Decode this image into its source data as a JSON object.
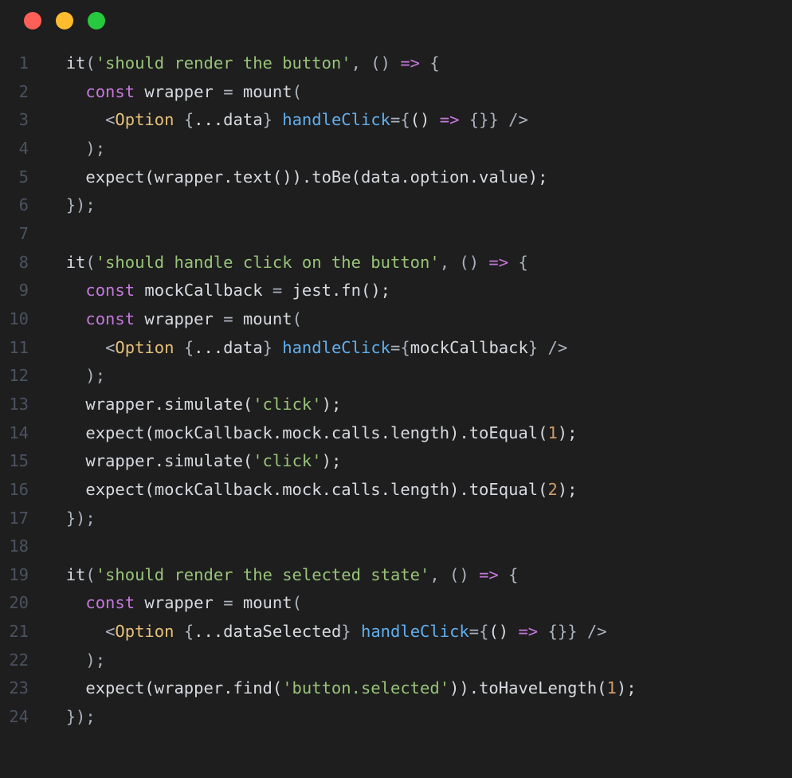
{
  "window": {
    "dots": [
      "red",
      "yellow",
      "green"
    ]
  },
  "colors": {
    "background": "#1e1e1e",
    "gutter": "#4a5260",
    "default": "#d7dae0",
    "keyword": "#c678dd",
    "attribute": "#61afef",
    "component": "#e5c07b",
    "string": "#98c379",
    "number": "#d19a66",
    "arrow": "#c678dd",
    "punct": "#abb2bf"
  },
  "lines": [
    {
      "n": "1",
      "indent": "  ",
      "tokens": [
        {
          "c": "fn",
          "t": "it"
        },
        {
          "c": "punc",
          "t": "("
        },
        {
          "c": "str",
          "t": "'should render the button'"
        },
        {
          "c": "punc",
          "t": ", () "
        },
        {
          "c": "arrow",
          "t": "=>"
        },
        {
          "c": "punc",
          "t": " {"
        }
      ]
    },
    {
      "n": "2",
      "indent": "    ",
      "tokens": [
        {
          "c": "kw",
          "t": "const"
        },
        {
          "c": "fn",
          "t": " wrapper "
        },
        {
          "c": "punc",
          "t": "="
        },
        {
          "c": "fn",
          "t": " mount"
        },
        {
          "c": "punc",
          "t": "("
        }
      ]
    },
    {
      "n": "3",
      "indent": "      ",
      "tokens": [
        {
          "c": "tag",
          "t": "<"
        },
        {
          "c": "comp",
          "t": "Option"
        },
        {
          "c": "fn",
          "t": " "
        },
        {
          "c": "punc",
          "t": "{"
        },
        {
          "c": "fn",
          "t": "...data"
        },
        {
          "c": "punc",
          "t": "} "
        },
        {
          "c": "blue",
          "t": "handleClick"
        },
        {
          "c": "punc",
          "t": "="
        },
        {
          "c": "punc",
          "t": "{"
        },
        {
          "c": "fn",
          "t": "() "
        },
        {
          "c": "arrow",
          "t": "=>"
        },
        {
          "c": "fn",
          "t": " "
        },
        {
          "c": "punc",
          "t": "{}"
        },
        {
          "c": "punc",
          "t": "}"
        },
        {
          "c": "tag",
          "t": " />"
        }
      ]
    },
    {
      "n": "4",
      "indent": "    ",
      "tokens": [
        {
          "c": "punc",
          "t": ");"
        }
      ]
    },
    {
      "n": "5",
      "indent": "    ",
      "tokens": [
        {
          "c": "fn",
          "t": "expect(wrapper.text()).toBe(data.option.value);"
        }
      ]
    },
    {
      "n": "6",
      "indent": "  ",
      "tokens": [
        {
          "c": "punc",
          "t": "});"
        }
      ]
    },
    {
      "n": "7",
      "indent": "",
      "tokens": []
    },
    {
      "n": "8",
      "indent": "  ",
      "tokens": [
        {
          "c": "fn",
          "t": "it"
        },
        {
          "c": "punc",
          "t": "("
        },
        {
          "c": "str",
          "t": "'should handle click on the button'"
        },
        {
          "c": "punc",
          "t": ", () "
        },
        {
          "c": "arrow",
          "t": "=>"
        },
        {
          "c": "punc",
          "t": " {"
        }
      ]
    },
    {
      "n": "9",
      "indent": "    ",
      "tokens": [
        {
          "c": "kw",
          "t": "const"
        },
        {
          "c": "fn",
          "t": " mockCallback "
        },
        {
          "c": "punc",
          "t": "="
        },
        {
          "c": "fn",
          "t": " jest.fn();"
        }
      ]
    },
    {
      "n": "10",
      "indent": "    ",
      "tokens": [
        {
          "c": "kw",
          "t": "const"
        },
        {
          "c": "fn",
          "t": " wrapper "
        },
        {
          "c": "punc",
          "t": "="
        },
        {
          "c": "fn",
          "t": " mount"
        },
        {
          "c": "punc",
          "t": "("
        }
      ]
    },
    {
      "n": "11",
      "indent": "      ",
      "tokens": [
        {
          "c": "tag",
          "t": "<"
        },
        {
          "c": "comp",
          "t": "Option"
        },
        {
          "c": "fn",
          "t": " "
        },
        {
          "c": "punc",
          "t": "{"
        },
        {
          "c": "fn",
          "t": "...data"
        },
        {
          "c": "punc",
          "t": "} "
        },
        {
          "c": "blue",
          "t": "handleClick"
        },
        {
          "c": "punc",
          "t": "="
        },
        {
          "c": "punc",
          "t": "{"
        },
        {
          "c": "fn",
          "t": "mockCallback"
        },
        {
          "c": "punc",
          "t": "}"
        },
        {
          "c": "tag",
          "t": " />"
        }
      ]
    },
    {
      "n": "12",
      "indent": "    ",
      "tokens": [
        {
          "c": "punc",
          "t": ");"
        }
      ]
    },
    {
      "n": "13",
      "indent": "    ",
      "tokens": [
        {
          "c": "fn",
          "t": "wrapper.simulate("
        },
        {
          "c": "str",
          "t": "'click'"
        },
        {
          "c": "fn",
          "t": ");"
        }
      ]
    },
    {
      "n": "14",
      "indent": "    ",
      "tokens": [
        {
          "c": "fn",
          "t": "expect(mockCallback.mock.calls.length).toEqual("
        },
        {
          "c": "num",
          "t": "1"
        },
        {
          "c": "fn",
          "t": ");"
        }
      ]
    },
    {
      "n": "15",
      "indent": "    ",
      "tokens": [
        {
          "c": "fn",
          "t": "wrapper.simulate("
        },
        {
          "c": "str",
          "t": "'click'"
        },
        {
          "c": "fn",
          "t": ");"
        }
      ]
    },
    {
      "n": "16",
      "indent": "    ",
      "tokens": [
        {
          "c": "fn",
          "t": "expect(mockCallback.mock.calls.length).toEqual("
        },
        {
          "c": "num",
          "t": "2"
        },
        {
          "c": "fn",
          "t": ");"
        }
      ]
    },
    {
      "n": "17",
      "indent": "  ",
      "tokens": [
        {
          "c": "punc",
          "t": "});"
        }
      ]
    },
    {
      "n": "18",
      "indent": "",
      "tokens": []
    },
    {
      "n": "19",
      "indent": "  ",
      "tokens": [
        {
          "c": "fn",
          "t": "it"
        },
        {
          "c": "punc",
          "t": "("
        },
        {
          "c": "str",
          "t": "'should render the selected state'"
        },
        {
          "c": "punc",
          "t": ", () "
        },
        {
          "c": "arrow",
          "t": "=>"
        },
        {
          "c": "punc",
          "t": " {"
        }
      ]
    },
    {
      "n": "20",
      "indent": "    ",
      "tokens": [
        {
          "c": "kw",
          "t": "const"
        },
        {
          "c": "fn",
          "t": " wrapper "
        },
        {
          "c": "punc",
          "t": "="
        },
        {
          "c": "fn",
          "t": " mount"
        },
        {
          "c": "punc",
          "t": "("
        }
      ]
    },
    {
      "n": "21",
      "indent": "      ",
      "tokens": [
        {
          "c": "tag",
          "t": "<"
        },
        {
          "c": "comp",
          "t": "Option"
        },
        {
          "c": "fn",
          "t": " "
        },
        {
          "c": "punc",
          "t": "{"
        },
        {
          "c": "fn",
          "t": "...dataSelected"
        },
        {
          "c": "punc",
          "t": "} "
        },
        {
          "c": "blue",
          "t": "handleClick"
        },
        {
          "c": "punc",
          "t": "="
        },
        {
          "c": "punc",
          "t": "{"
        },
        {
          "c": "fn",
          "t": "() "
        },
        {
          "c": "arrow",
          "t": "=>"
        },
        {
          "c": "fn",
          "t": " "
        },
        {
          "c": "punc",
          "t": "{}"
        },
        {
          "c": "punc",
          "t": "}"
        },
        {
          "c": "tag",
          "t": " />"
        }
      ]
    },
    {
      "n": "22",
      "indent": "    ",
      "tokens": [
        {
          "c": "punc",
          "t": ");"
        }
      ]
    },
    {
      "n": "23",
      "indent": "    ",
      "tokens": [
        {
          "c": "fn",
          "t": "expect(wrapper.find("
        },
        {
          "c": "str",
          "t": "'button.selected'"
        },
        {
          "c": "fn",
          "t": ")).toHaveLength("
        },
        {
          "c": "num",
          "t": "1"
        },
        {
          "c": "fn",
          "t": ");"
        }
      ]
    },
    {
      "n": "24",
      "indent": "  ",
      "tokens": [
        {
          "c": "punc",
          "t": "});"
        }
      ]
    }
  ]
}
